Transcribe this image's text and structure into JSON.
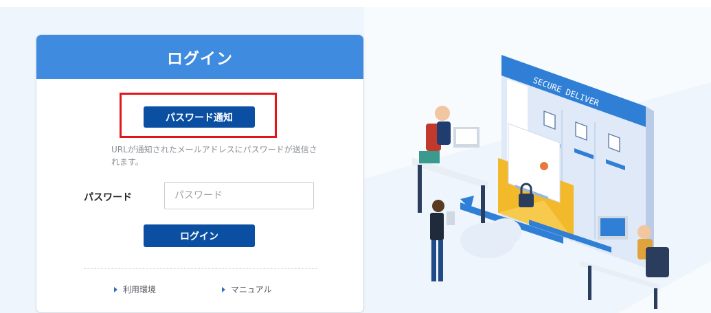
{
  "login": {
    "title": "ログイン",
    "notify_button": "パスワード通知",
    "hint": "URLが通知されたメールアドレスにパスワードが送信されます。",
    "password_label": "パスワード",
    "password_placeholder": "パスワード",
    "password_value": "",
    "login_button": "ログイン",
    "links": {
      "environment": "利用環境",
      "manual": "マニュアル"
    }
  },
  "illustration": {
    "sign_text": "SECURE DELIVER"
  },
  "colors": {
    "header": "#3e8be0",
    "button": "#0b4fa3",
    "highlight": "#e0161a",
    "background": "#eef5fd"
  }
}
